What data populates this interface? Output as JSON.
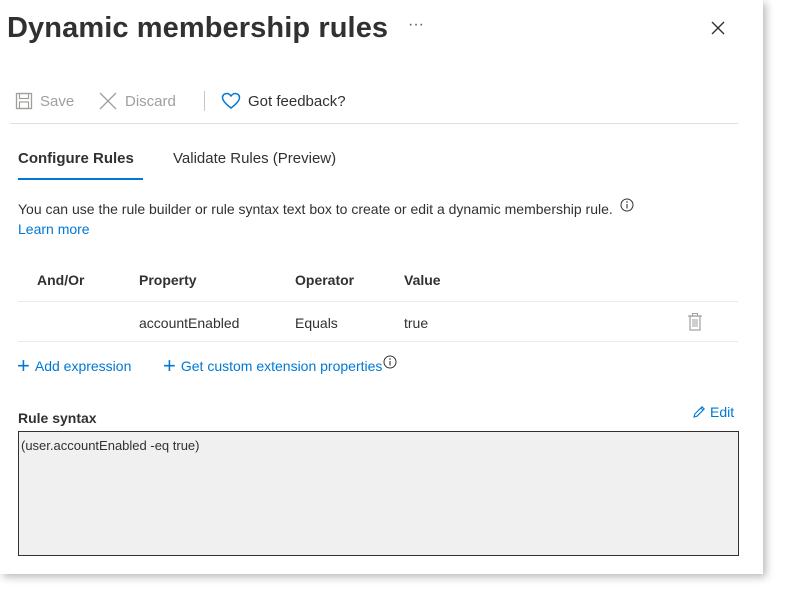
{
  "header": {
    "title": "Dynamic membership rules",
    "more": "···",
    "close_icon": "close-icon"
  },
  "toolbar": {
    "save_label": "Save",
    "discard_label": "Discard",
    "feedback_label": "Got feedback?",
    "icons": [
      "save-icon",
      "discard-icon",
      "heart-icon"
    ]
  },
  "tabs": [
    {
      "label": "Configure Rules",
      "active": true
    },
    {
      "label": "Validate Rules (Preview)",
      "active": false
    }
  ],
  "description": {
    "text": "You can use the rule builder or rule syntax text box to create or edit a dynamic membership rule.",
    "learn_more": "Learn more"
  },
  "rules_table": {
    "columns": [
      "And/Or",
      "Property",
      "Operator",
      "Value"
    ],
    "rows": [
      {
        "and_or": "",
        "property": "accountEnabled",
        "operator": "Equals",
        "value": "true"
      }
    ]
  },
  "actions": {
    "add_expression": "Add expression",
    "custom_extension": "Get custom extension properties"
  },
  "rule_syntax": {
    "label": "Rule syntax",
    "edit_label": "Edit",
    "value": "(user.accountEnabled -eq true)"
  },
  "colors": {
    "accent": "#0078d4",
    "text": "#323130",
    "disabled": "#a19f9d",
    "syntax_bg": "#f0f0f0"
  }
}
